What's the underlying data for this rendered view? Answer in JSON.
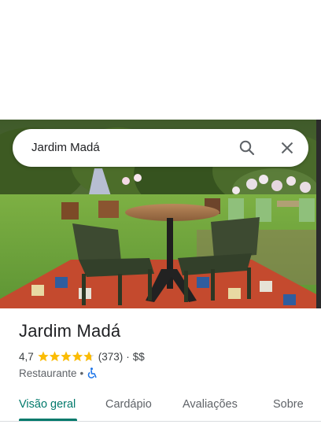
{
  "search": {
    "query": "Jardim Madá"
  },
  "place": {
    "name": "Jardim Madá",
    "rating": "4,7",
    "rating_value": 4.7,
    "reviews": "(373)",
    "separator": "·",
    "price": "$$",
    "category": "Restaurante",
    "category_separator": "•",
    "accessibility_icon": "wheelchair-icon"
  },
  "tabs": [
    {
      "label": "Visão geral",
      "active": true
    },
    {
      "label": "Cardápio",
      "active": false
    },
    {
      "label": "Avaliações",
      "active": false
    },
    {
      "label": "Sobre",
      "active": false
    }
  ],
  "colors": {
    "accent": "#00796b",
    "star": "#fbbc04",
    "wheelchair": "#1a73e8"
  }
}
